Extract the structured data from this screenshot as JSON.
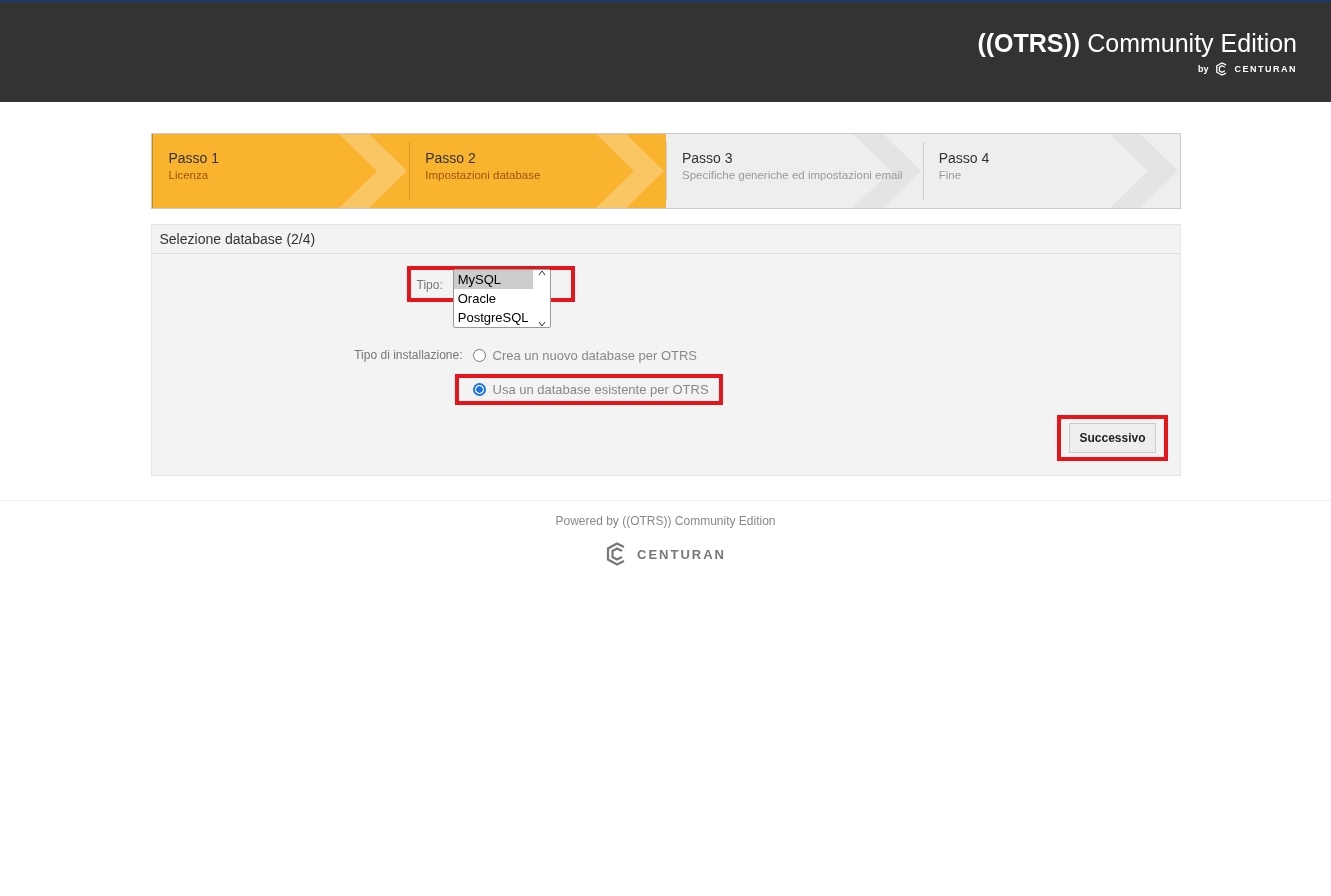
{
  "header": {
    "logo_main": "((OTRS))",
    "logo_rest": "Community Edition",
    "logo_by": "by",
    "logo_brand": "CENTURAN"
  },
  "steps": [
    {
      "title": "Passo 1",
      "subtitle": "Licenza",
      "active": true
    },
    {
      "title": "Passo 2",
      "subtitle": "Impostazioni database",
      "active": true
    },
    {
      "title": "Passo 3",
      "subtitle": "Specifiche generiche ed impostazioni email",
      "active": false
    },
    {
      "title": "Passo 4",
      "subtitle": "Fine",
      "active": false
    }
  ],
  "panel": {
    "title": "Selezione database (2/4)",
    "type_field": {
      "label": "Tipo:",
      "highlighted": true,
      "options": [
        {
          "label": "MySQL",
          "selected": true
        },
        {
          "label": "Oracle",
          "selected": false
        },
        {
          "label": "PostgreSQL",
          "selected": false
        }
      ]
    },
    "install_field": {
      "label": "Tipo di installazione:",
      "options": [
        {
          "label": "Crea un nuovo database per OTRS",
          "selected": false,
          "highlighted": false
        },
        {
          "label": "Usa un database esistente per OTRS",
          "selected": true,
          "highlighted": true
        }
      ]
    },
    "button": {
      "label": "Successivo",
      "highlighted": true
    }
  },
  "footer": {
    "powered": "Powered by ((OTRS)) Community Edition",
    "brand": "CENTURAN"
  }
}
